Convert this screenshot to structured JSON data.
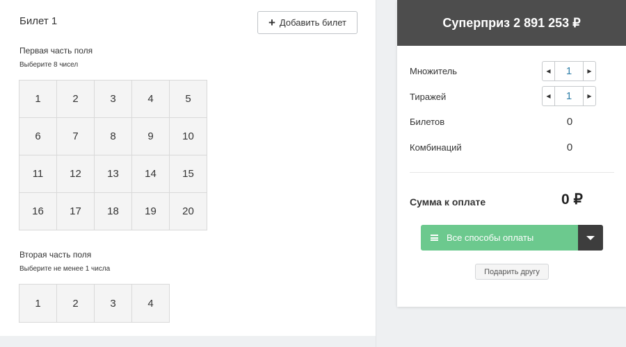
{
  "ticket": {
    "title": "Билет 1",
    "add_button_label": "Добавить билет",
    "field1": {
      "title": "Первая часть поля",
      "hint": "Выберите 8 чисел",
      "numbers": [
        "1",
        "2",
        "3",
        "4",
        "5",
        "6",
        "7",
        "8",
        "9",
        "10",
        "11",
        "12",
        "13",
        "14",
        "15",
        "16",
        "17",
        "18",
        "19",
        "20"
      ]
    },
    "field2": {
      "title": "Вторая часть поля",
      "hint": "Выберите не менее 1 числа",
      "numbers": [
        "1",
        "2",
        "3",
        "4"
      ]
    }
  },
  "summary": {
    "superprize": "Суперприз 2 891 253 ₽",
    "multiplier_label": "Множитель",
    "multiplier_value": "1",
    "draws_label": "Тиражей",
    "draws_value": "1",
    "tickets_label": "Билетов",
    "tickets_value": "0",
    "combinations_label": "Комбинаций",
    "combinations_value": "0",
    "total_label": "Сумма к оплате",
    "total_value": "0 ₽",
    "pay_button_label": "Все способы оплаты",
    "gift_button_label": "Подарить другу"
  },
  "icons": [
    "plus-icon",
    "chevron-left-icon",
    "chevron-right-icon",
    "list-icon",
    "caret-down-icon"
  ],
  "colors": {
    "header_bg": "#4d4d4d",
    "pay_green": "#6cc98e",
    "pay_caret": "#3d3d3d",
    "stepper_value": "#2f7fa8"
  }
}
